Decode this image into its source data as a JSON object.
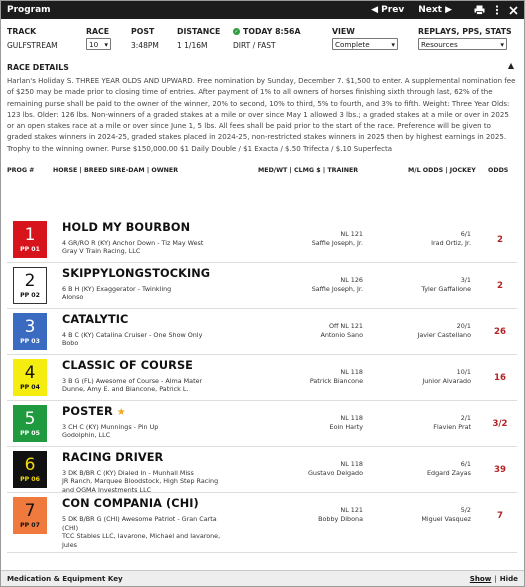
{
  "topbar": {
    "title": "Program",
    "prev": "◀ Prev",
    "next": "Next ▶"
  },
  "header": {
    "track_label": "TRACK",
    "track_value": "GULFSTREAM",
    "race_label": "RACE",
    "race_value": "10",
    "post_label": "POST",
    "post_value": "3:48PM",
    "distance_label": "DISTANCE",
    "distance_value": "1 1/16M",
    "today_label": "TODAY 8:56A",
    "surface_value": "DIRT / FAST",
    "view_label": "VIEW",
    "view_value": "Complete",
    "replays_label": "REPLAYS, PPS, STATS",
    "replays_value": "Resources"
  },
  "race_details": {
    "title": "RACE DETAILS",
    "race_name": "Harlan's Holiday S.",
    "text": "THREE YEAR OLDS AND UPWARD. Free nomination by Sunday, December 7. $1,500 to enter. A supplemental nomination fee of $250 may be made prior to closing time of entries. After payment of 1% to all owners of horses finishing sixth through last, 62% of the remaining purse shall be paid to the owner of the winner, 20% to second, 10% to third, 5% to fourth, and 3% to fifth. Weight: Three Year Olds: 123 lbs. Older: 126 lbs. Non-winners of a graded stakes at a mile or over since May 1 allowed 3 lbs.; a graded stakes at a mile or over in 2025 or an open stakes race at a mile or over since June 1, 5 lbs. All fees shall be paid prior to the start of the race. Preference will be given to graded stakes winners in 2024-25, graded stakes placed in 2024-25, non-restricted stakes winners in 2025 then by highest earnings in 2025. Trophy to the winning owner. Purse $150,000.00 $1 Daily Double / $1 Exacta / $.50 Trifecta / $.10 Superfecta"
  },
  "columns": {
    "prog": "PROG #",
    "horse": "HORSE | BREED SIRE-DAM | OWNER",
    "med": "MED/WT | CLMG $ | TRAINER",
    "ml": "M/L ODDS | JOCKEY",
    "odds": "ODDS"
  },
  "entries": [
    {
      "num": "1",
      "pp": "PP 01",
      "bg": "#d7141c",
      "fg": "#ffffff",
      "border": "#d7141c",
      "name": "HOLD MY BOURBON",
      "star": "",
      "breed": "4 GR/RO R (KY) Anchor Down - Tiz May West",
      "owner": "Gray V Train Racing, LLC",
      "med": "NL 121",
      "trainer": "Saffie Joseph, Jr.",
      "ml": "6/1",
      "jockey": "Irad Ortiz, Jr.",
      "odds": "2"
    },
    {
      "num": "2",
      "pp": "PP 02",
      "bg": "#ffffff",
      "fg": "#111111",
      "border": "#333333",
      "name": "SKIPPYLONGSTOCKING",
      "star": "",
      "breed": "6 B H (KY) Exaggerator - Twinkling",
      "owner": "Alonso",
      "med": "NL 126",
      "trainer": "Saffie Joseph, Jr.",
      "ml": "3/1",
      "jockey": "Tyler Gaffalione",
      "odds": "2"
    },
    {
      "num": "3",
      "pp": "PP 03",
      "bg": "#3a6bc1",
      "fg": "#ffffff",
      "border": "#3a6bc1",
      "name": "CATALYTIC",
      "star": "",
      "breed": "4 B C (KY) Catalina Cruiser - One Show Only",
      "owner": "Bobo",
      "med": "Off NL 121",
      "trainer": "Antonio Sano",
      "ml": "20/1",
      "jockey": "Javier Castellano",
      "odds": "26"
    },
    {
      "num": "4",
      "pp": "PP 04",
      "bg": "#f5ed0f",
      "fg": "#111111",
      "border": "#f5ed0f",
      "name": "CLASSIC OF COURSE",
      "star": "",
      "breed": "3 B G (FL) Awesome of Course - Alma Mater",
      "owner": "Dunne, Amy E. and Biancone, Patrick L.",
      "med": "NL 118",
      "trainer": "Patrick Biancone",
      "ml": "10/1",
      "jockey": "Junior Alvarado",
      "odds": "16"
    },
    {
      "num": "5",
      "pp": "PP 05",
      "bg": "#1f9a3f",
      "fg": "#ffffff",
      "border": "#1f9a3f",
      "name": "POSTER",
      "star": "★",
      "breed": "3 CH C (KY) Munnings - Pin Up",
      "owner": "Godolphin, LLC",
      "med": "NL 118",
      "trainer": "Eoin Harty",
      "ml": "2/1",
      "jockey": "Flavien Prat",
      "odds": "3/2"
    },
    {
      "num": "6",
      "pp": "PP 06",
      "bg": "#111111",
      "fg": "#f5d90f",
      "border": "#111111",
      "name": "RACING DRIVER",
      "star": "",
      "breed": "3 DK B/BR C (KY) Dialed In - Munhall Miss",
      "owner": "JR Ranch, Marquee Bloodstock, High Step Racing and OGMA Investments LLC",
      "med": "NL 118",
      "trainer": "Gustavo Delgado",
      "ml": "6/1",
      "jockey": "Edgard Zayas",
      "odds": "39"
    },
    {
      "num": "7",
      "pp": "PP 07",
      "bg": "#f07a3d",
      "fg": "#111111",
      "border": "#f07a3d",
      "name": "CON COMPANIA (CHI)",
      "star": "",
      "breed": "5 DK B/BR G (CHI) Awesome Patriot - Gran Carta (CHI)",
      "owner": "TCC Stables LLC, Iavarone, Michael and Iavarone, Jules",
      "med": "NL 121",
      "trainer": "Bobby Dibona",
      "ml": "5/2",
      "jockey": "Miguel Vasquez",
      "odds": "7"
    }
  ],
  "footer": {
    "title": "Medication & Equipment Key",
    "show": "Show",
    "sep": "|",
    "hide": "Hide"
  }
}
